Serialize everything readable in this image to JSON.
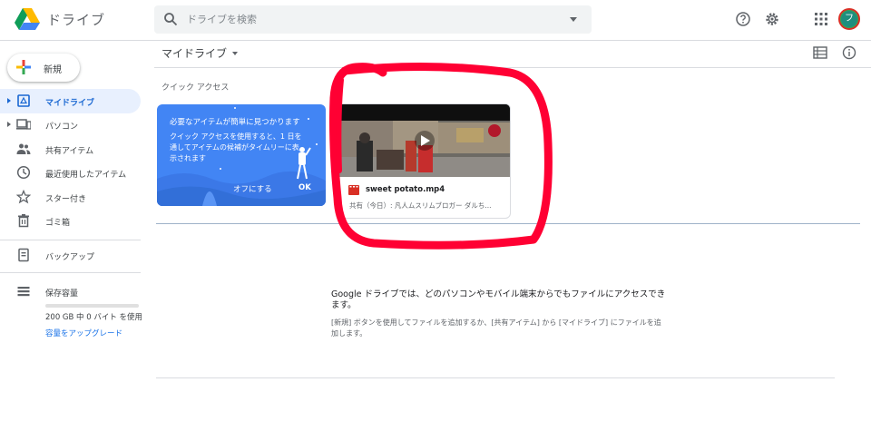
{
  "header": {
    "brand": "ドライブ",
    "search_placeholder": "ドライブを検索",
    "avatar_initial": "フ"
  },
  "sidebar": {
    "new_label": "新規",
    "items": [
      {
        "label": "マイドライブ",
        "icon": "my-drive-icon",
        "active": true
      },
      {
        "label": "パソコン",
        "icon": "computer-icon"
      },
      {
        "label": "共有アイテム",
        "icon": "people-icon"
      },
      {
        "label": "最近使用したアイテム",
        "icon": "clock-icon"
      },
      {
        "label": "スター付き",
        "icon": "star-icon"
      },
      {
        "label": "ゴミ箱",
        "icon": "trash-icon"
      },
      {
        "label": "バックアップ",
        "icon": "backup-icon"
      },
      {
        "label": "保存容量",
        "icon": "storage-icon"
      }
    ],
    "storage_text": "200 GB 中 0 バイト を使用",
    "upgrade_label": "容量をアップグレード",
    "storage_used_fraction": 0
  },
  "main": {
    "breadcrumb": "マイドライブ",
    "quick_access_title": "クイック アクセス",
    "promo": {
      "title": "必要なアイテムが簡単に見つかります",
      "body": "クイック アクセスを使用すると、1 日を通してアイテムの候補がタイムリーに表示されます",
      "dismiss": "オフにする",
      "ok": "OK"
    },
    "file": {
      "name": "sweet potato.mp4",
      "meta": "共有（今日）: 凡人ムスリムブロガー ダルち..."
    },
    "empty": {
      "title": "Google ドライブでは、どのパソコンやモバイル端末からでもファイルにアクセスできます。",
      "subtitle": "[新規] ボタンを使用してファイルを追加するか、[共有アイテム] から [マイドライブ] にファイルを追加します。"
    }
  },
  "colors": {
    "accent": "#1a73e8",
    "promo_bg": "#4285f4",
    "annotation_red": "#ff0033"
  }
}
